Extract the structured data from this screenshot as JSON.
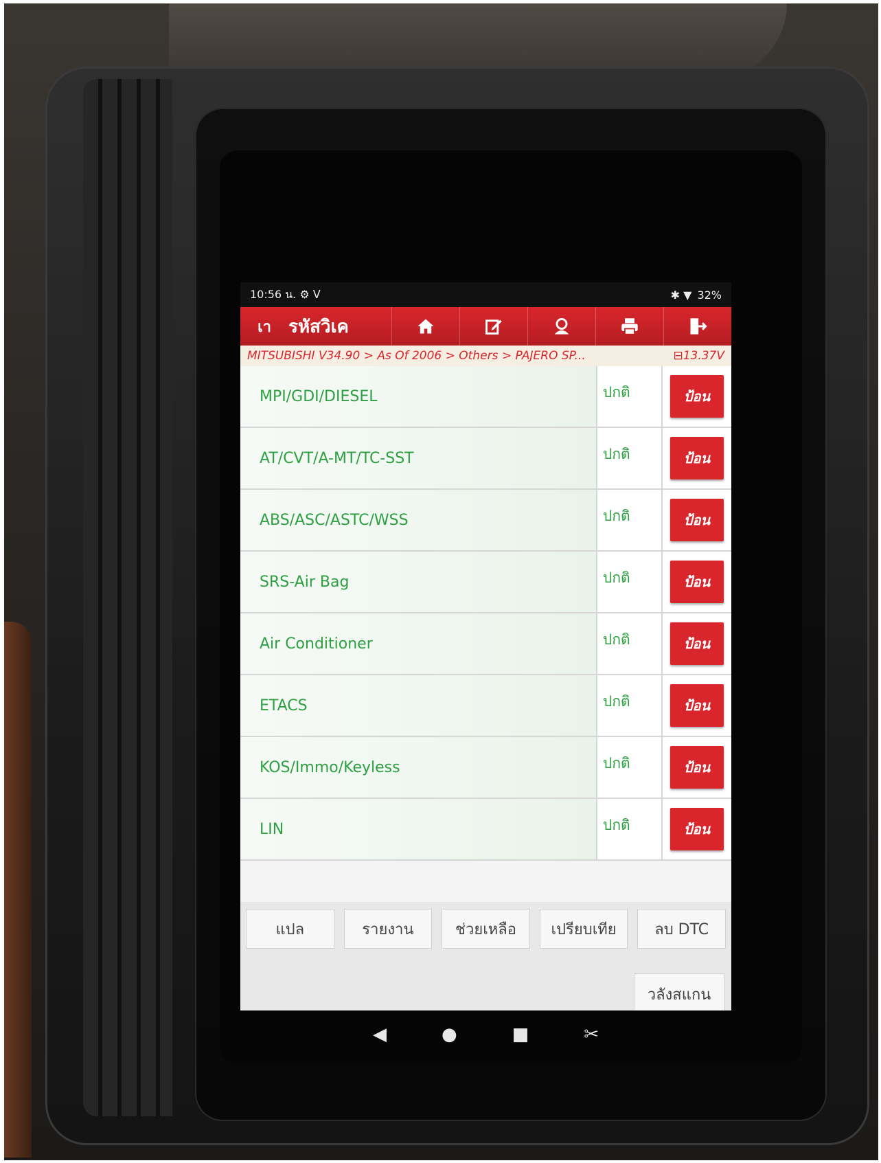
{
  "status_bar": {
    "time": "10:56 น.",
    "left_icons": "⚙ ᐯ",
    "right_icons": "✱ ▼",
    "battery": "32%"
  },
  "toolbar": {
    "back_label": "เา",
    "title": "รหัสวิเค",
    "buttons": [
      "home-icon",
      "edit-icon",
      "user-icon",
      "print-icon",
      "exit-icon"
    ],
    "color": "#d8262c"
  },
  "breadcrumb": {
    "path": "MITSUBISHI V34.90 > As Of 2006 > Others > PAJERO SP...",
    "voltage": "13.37V"
  },
  "systems": [
    {
      "name": "MPI/GDI/DIESEL",
      "status": "ปกติ",
      "action": "ป้อน"
    },
    {
      "name": "AT/CVT/A-MT/TC-SST",
      "status": "ปกติ",
      "action": "ป้อน"
    },
    {
      "name": "ABS/ASC/ASTC/WSS",
      "status": "ปกติ",
      "action": "ป้อน"
    },
    {
      "name": "SRS-Air Bag",
      "status": "ปกติ",
      "action": "ป้อน"
    },
    {
      "name": "Air Conditioner",
      "status": "ปกติ",
      "action": "ป้อน"
    },
    {
      "name": "ETACS",
      "status": "ปกติ",
      "action": "ป้อน"
    },
    {
      "name": "KOS/Immo/Keyless",
      "status": "ปกติ",
      "action": "ป้อน"
    },
    {
      "name": "LIN",
      "status": "ปกติ",
      "action": "ป้อน"
    }
  ],
  "actions": [
    "แปล",
    "รายงาน",
    "ช่วยเหลือ",
    "เปรียบเทีย",
    "ลบ DTC"
  ],
  "scan_button": "วลังสแกน",
  "nav": {
    "back": "◀",
    "home": "●",
    "recent": "■",
    "screenshot": "✂"
  }
}
